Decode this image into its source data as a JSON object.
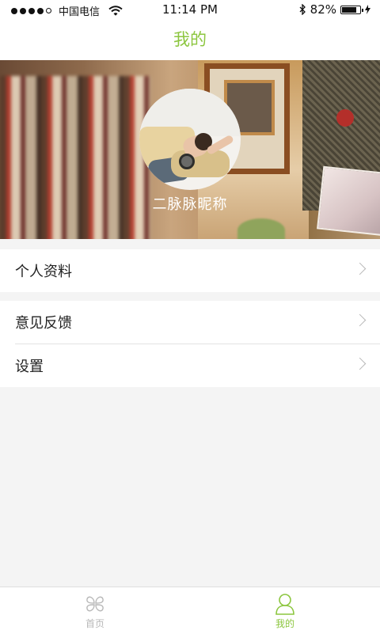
{
  "status_bar": {
    "carrier": "中国电信",
    "time": "11:14 PM",
    "battery": "82%",
    "battery_level": 0.82
  },
  "nav": {
    "title": "我的"
  },
  "profile": {
    "nickname": "二脉脉昵称"
  },
  "menu": {
    "profile_label": "个人资料",
    "feedback_label": "意见反馈",
    "settings_label": "设置"
  },
  "tabs": [
    {
      "label": "首页",
      "icon": "clover-icon",
      "active": false
    },
    {
      "label": "我的",
      "icon": "person-icon",
      "active": true
    }
  ],
  "colors": {
    "accent": "#8cc63f",
    "inactive": "#b8b8b8",
    "background": "#f4f4f4"
  }
}
